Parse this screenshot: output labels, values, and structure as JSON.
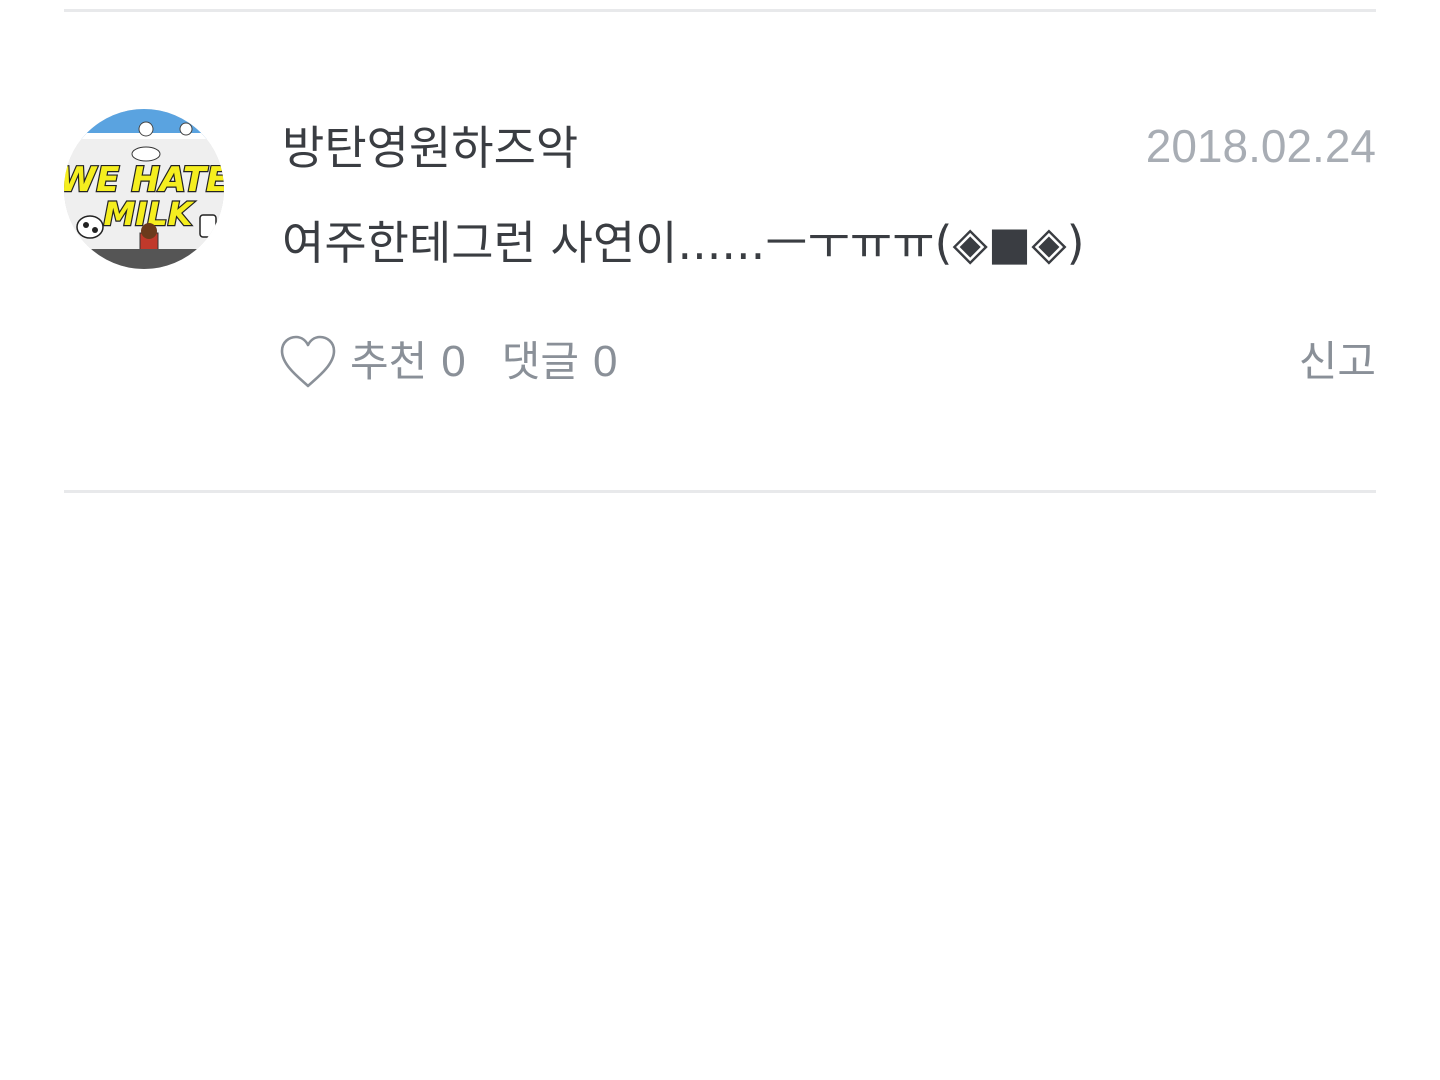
{
  "comment": {
    "author": "방탄영원하즈악",
    "date": "2018.02.24",
    "text": "여주한테그런 사연이......ㅡㅜㅠㅠ(◈■◈)",
    "avatar": {
      "logo_text_line1": "WE HATE",
      "logo_text_line2": "MILK",
      "accent_color": "#f5ee1f",
      "sky_color": "#5aa3e0"
    },
    "actions": {
      "like_label": "추천",
      "like_count": "0",
      "reply_label": "댓글",
      "reply_count": "0",
      "report_label": "신고"
    }
  }
}
